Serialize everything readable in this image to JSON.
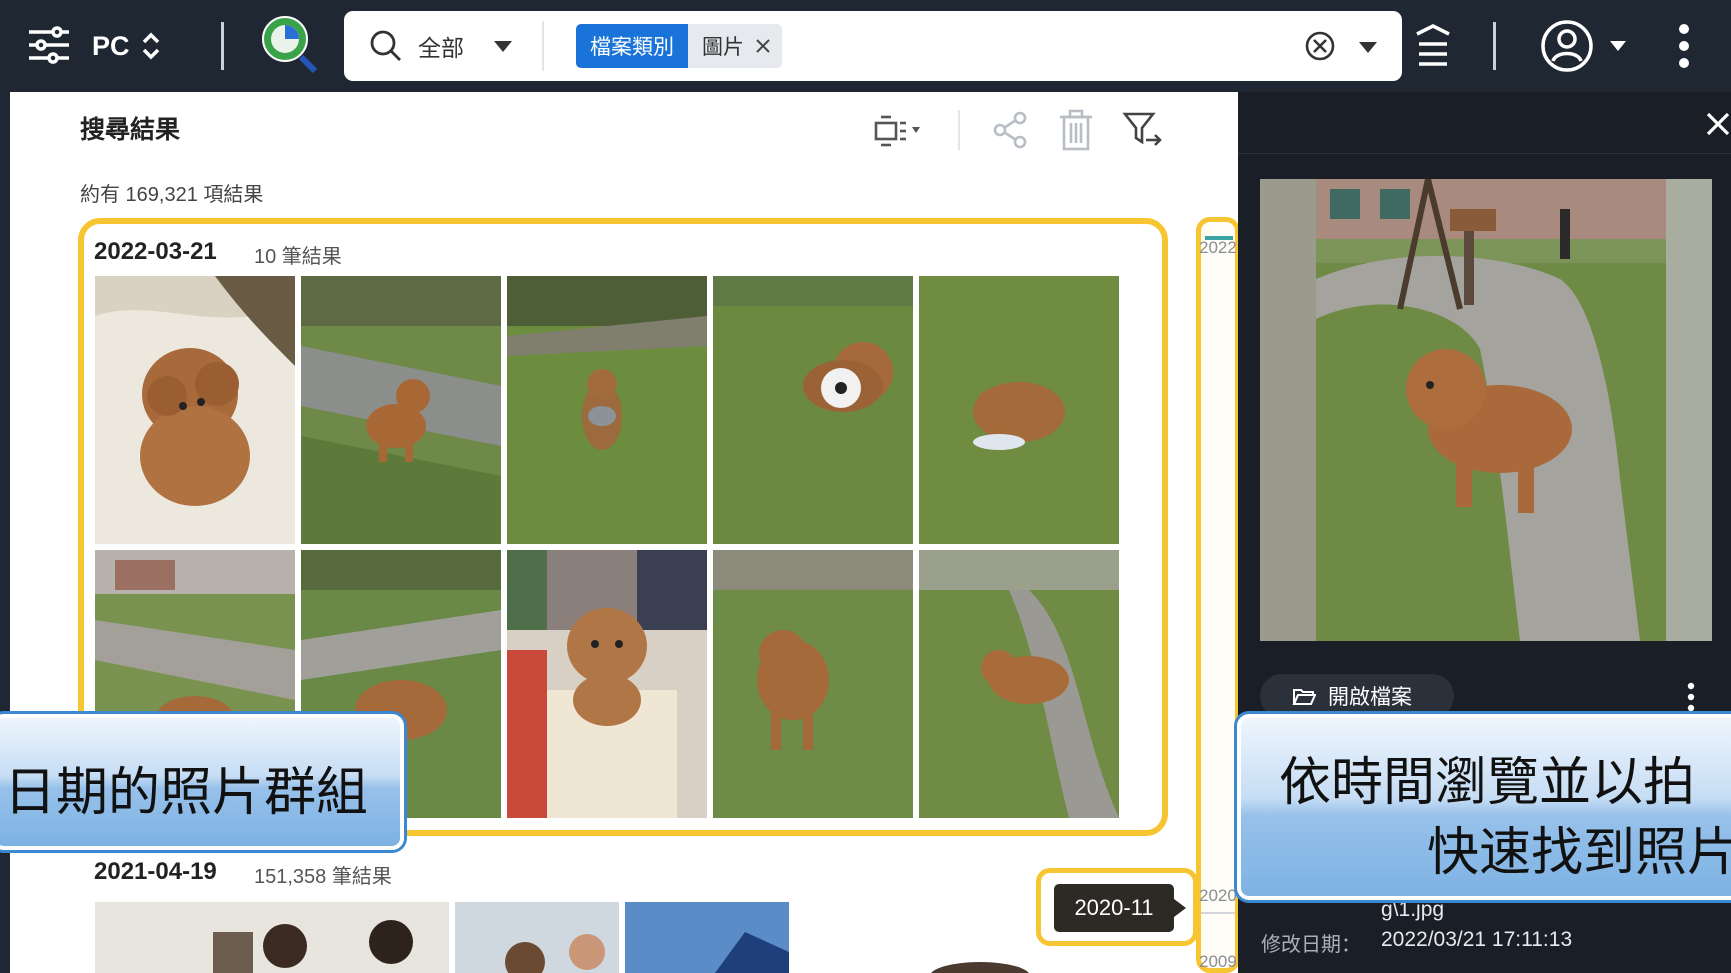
{
  "topbar": {
    "source_label": "PC",
    "search": {
      "scope_label": "全部",
      "chip_key": "檔案類別",
      "chip_value": "圖片"
    }
  },
  "results": {
    "title": "搜尋結果",
    "count_text": "約有 169,321 項結果",
    "groups": [
      {
        "date": "2022-03-21",
        "count": "10 筆結果"
      },
      {
        "date": "2021-04-19",
        "count": "151,358 筆結果"
      }
    ]
  },
  "timeline": {
    "years": [
      "2022",
      "2020",
      "2009"
    ],
    "tooltip": "2020-11"
  },
  "preview": {
    "open_button": "開啟檔案",
    "filename_fragment": "g\\1.jpg",
    "modified_label": "修改日期：",
    "modified_value": "2022/03/21 17:11:13"
  },
  "callouts": {
    "left": "日期的照片群組",
    "right_line1": "依時間瀏覽並以拍",
    "right_line2": "快速找到照片"
  },
  "colors": {
    "accent_blue": "#1a73d8",
    "highlight_yellow": "#f7c531",
    "topbar_bg": "#1f2733"
  }
}
